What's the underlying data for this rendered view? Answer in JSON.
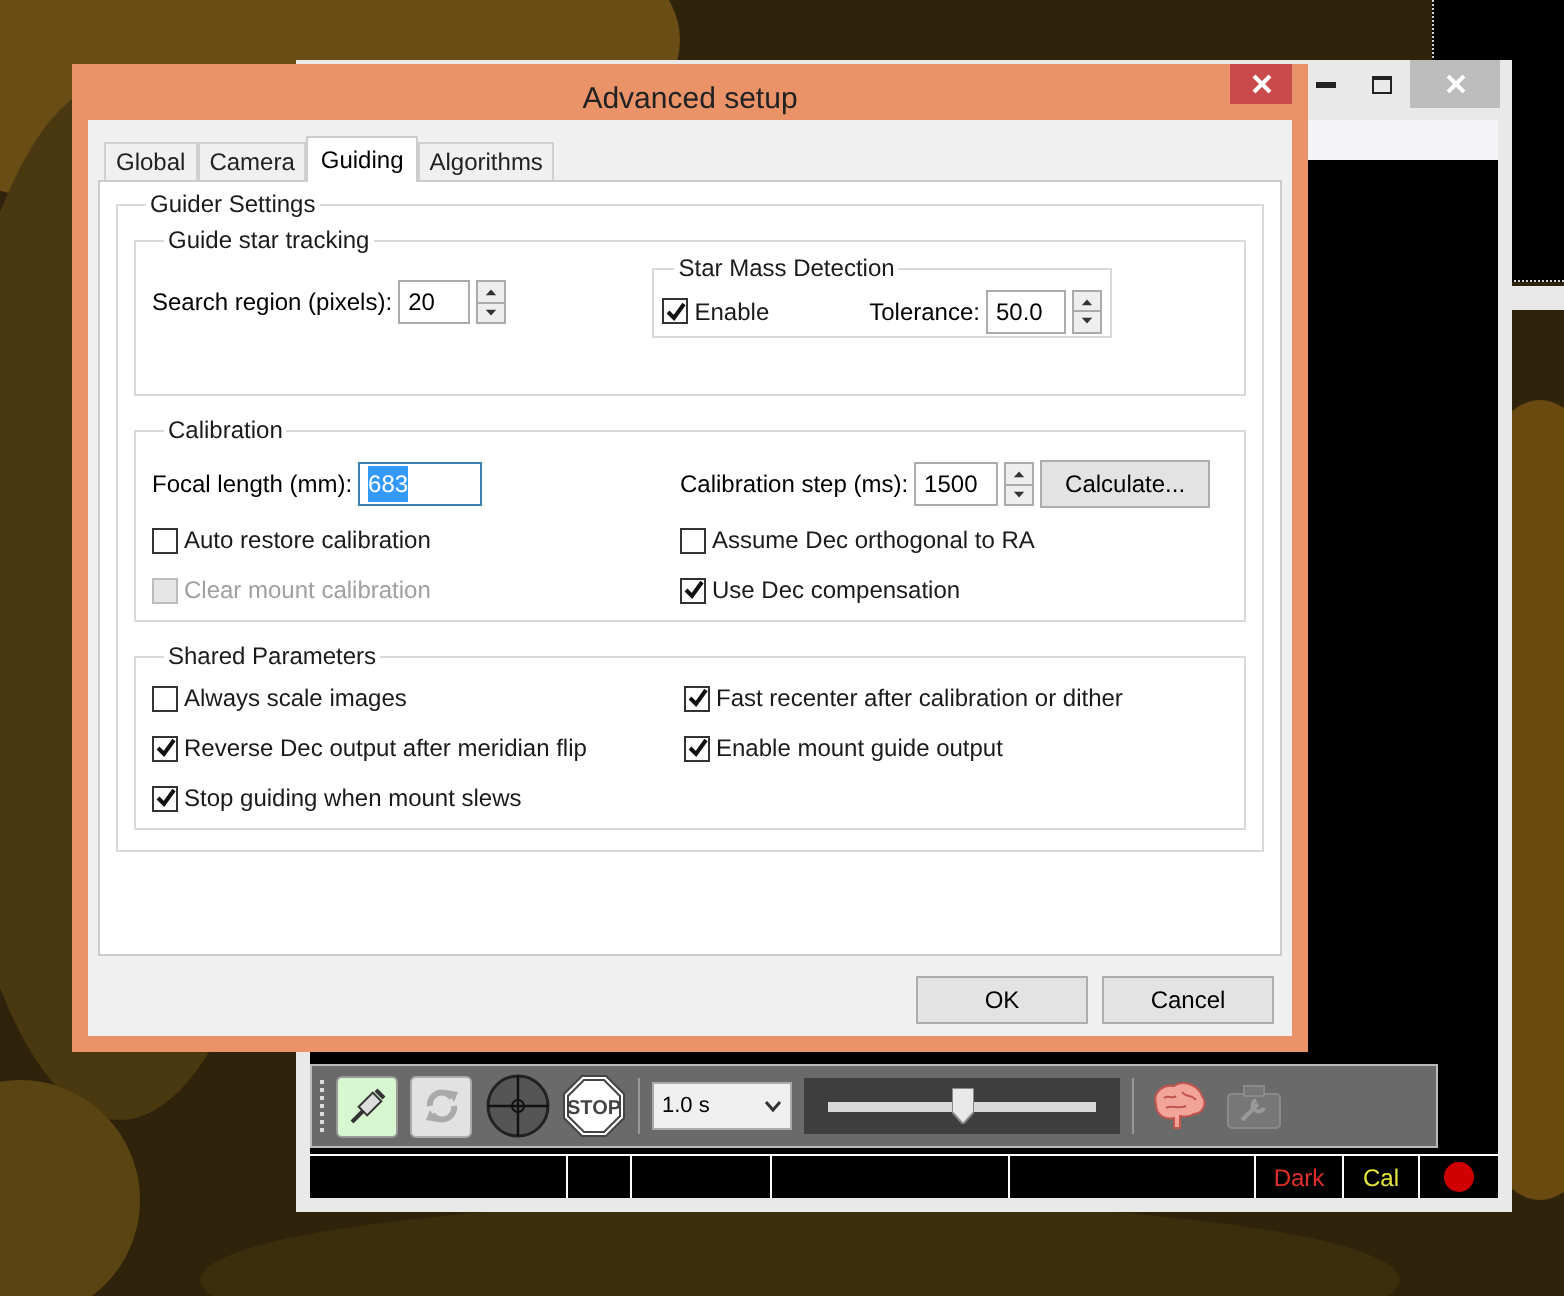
{
  "dialog": {
    "title": "Advanced setup"
  },
  "tabs": [
    {
      "label": "Global",
      "selected": false
    },
    {
      "label": "Camera",
      "selected": false
    },
    {
      "label": "Guiding",
      "selected": true
    },
    {
      "label": "Algorithms",
      "selected": false
    }
  ],
  "guider_settings": {
    "title": "Guider Settings",
    "tracking": {
      "title": "Guide star tracking",
      "search_region": {
        "label": "Search region (pixels):",
        "value": "20"
      },
      "star_mass": {
        "title": "Star Mass Detection",
        "enable": {
          "label": "Enable",
          "checked": true
        },
        "tolerance": {
          "label": "Tolerance:",
          "value": "50.0"
        }
      }
    },
    "calibration": {
      "title": "Calibration",
      "focal_length": {
        "label": "Focal length (mm):",
        "value": "683",
        "focused": true
      },
      "calibration_step": {
        "label": "Calibration step (ms):",
        "value": "1500"
      },
      "calculate_button": "Calculate...",
      "options": [
        {
          "label": "Auto restore calibration",
          "checked": false,
          "disabled": false
        },
        {
          "label": "Assume Dec orthogonal to RA",
          "checked": false,
          "disabled": false
        },
        {
          "label": "Clear mount calibration",
          "checked": false,
          "disabled": true
        },
        {
          "label": "Use Dec compensation",
          "checked": true,
          "disabled": false
        }
      ]
    },
    "shared": {
      "title": "Shared Parameters",
      "options": [
        {
          "label": "Always scale images",
          "checked": false,
          "disabled": false
        },
        {
          "label": "Fast recenter after calibration or dither",
          "checked": true,
          "disabled": false
        },
        {
          "label": "Reverse Dec output after meridian flip",
          "checked": true,
          "disabled": false
        },
        {
          "label": "Enable mount guide output",
          "checked": true,
          "disabled": false
        },
        {
          "label": "Stop guiding when mount slews",
          "checked": true,
          "disabled": false
        }
      ]
    }
  },
  "buttons": [
    "OK",
    "Cancel"
  ],
  "main_window": {
    "toolbar": {
      "stop_label": "STOP",
      "exposure": "1.0 s",
      "gain": {
        "level": 0.5
      }
    },
    "status_bar": [
      {
        "label": "Dark",
        "color": "#e0302a"
      },
      {
        "label": "Cal",
        "color": "#e6e640"
      }
    ]
  }
}
